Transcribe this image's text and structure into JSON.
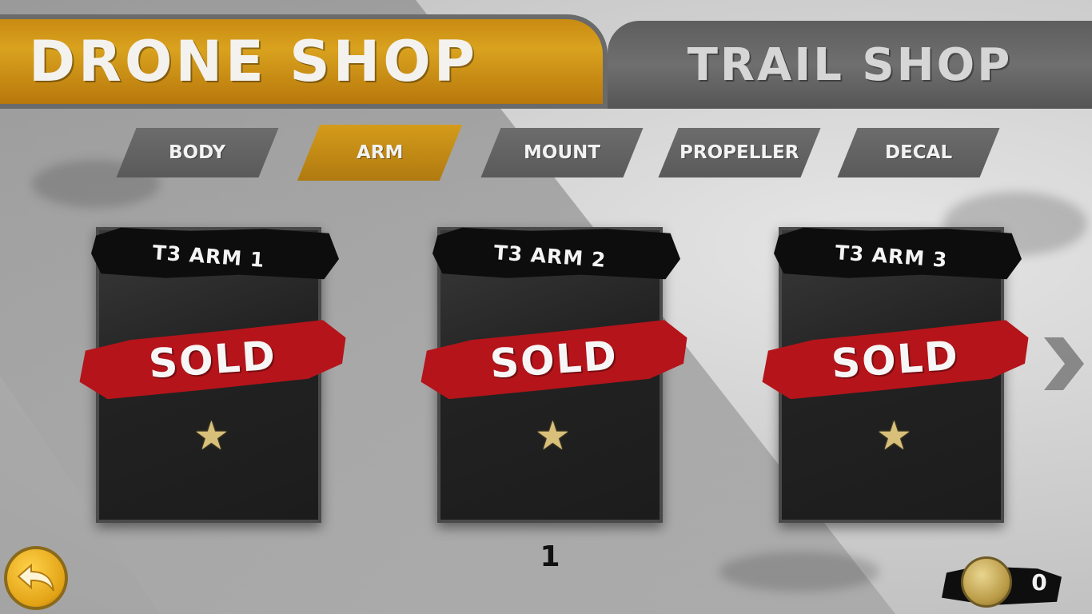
{
  "main_tabs": [
    {
      "label": "DRONE SHOP",
      "active": true
    },
    {
      "label": "TRAIL SHOP",
      "active": false
    }
  ],
  "sub_tabs": [
    {
      "label": "BODY",
      "active": false
    },
    {
      "label": "ARM",
      "active": true
    },
    {
      "label": "MOUNT",
      "active": false
    },
    {
      "label": "PROPELLER",
      "active": false
    },
    {
      "label": "DECAL",
      "active": false
    }
  ],
  "cards": [
    {
      "title": "T3 ARM 1",
      "status": "SOLD",
      "icon": "star-icon"
    },
    {
      "title": "T3 ARM 2",
      "status": "SOLD",
      "icon": "star-icon"
    },
    {
      "title": "T3 ARM 3",
      "status": "SOLD",
      "icon": "star-icon"
    }
  ],
  "page": "1",
  "currency": {
    "amount": "0",
    "icon": "coin-icon"
  },
  "colors": {
    "accent": "#d49b1a",
    "sold": "#b5141a",
    "inactive_tab": "#5e5e5e"
  }
}
